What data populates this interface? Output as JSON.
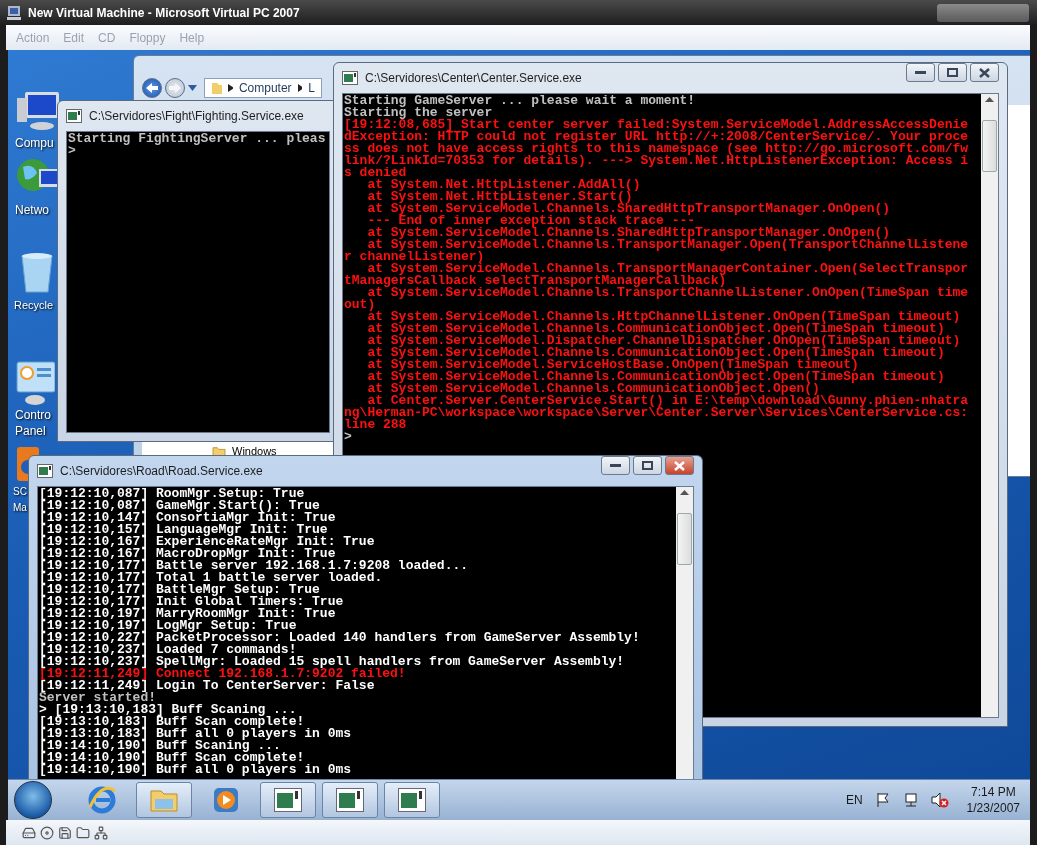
{
  "host": {
    "title": "New Virtual Machine - Microsoft Virtual PC 2007",
    "menu": [
      {
        "label": "Action",
        "disabled": true
      },
      {
        "label": "Edit",
        "disabled": true
      },
      {
        "label": "CD",
        "disabled": true
      },
      {
        "label": "Floppy",
        "disabled": true
      },
      {
        "label": "Help",
        "disabled": true
      }
    ]
  },
  "desktop_icons": [
    {
      "kind": "computer",
      "label": [
        "Compu"
      ]
    },
    {
      "kind": "network",
      "label": [
        "Netwo"
      ]
    },
    {
      "kind": "recycle",
      "label": [
        "Recycle"
      ]
    },
    {
      "kind": "control",
      "label": [
        "Contro",
        "Panel"
      ]
    },
    {
      "kind": "app",
      "label": [
        "SC",
        "Ma"
      ]
    }
  ],
  "explorer": {
    "breadcrumb": [
      "Computer",
      "L"
    ],
    "folder": "Windows"
  },
  "windows": [
    {
      "title": "C:\\Servidores\\Fight\\Fighting.Service.exe",
      "active": false,
      "lines": [
        {
          "kind": "info",
          "text": "Starting FightingServer ... pleas"
        },
        {
          "kind": "info",
          "text": ">"
        }
      ]
    },
    {
      "title": "C:\\Servidores\\Center\\Center.Service.exe",
      "active": false,
      "lines": [
        {
          "kind": "info",
          "text": "Starting GameServer ... please wait a moment!"
        },
        {
          "kind": "info",
          "text": "Starting the server"
        },
        {
          "kind": "error",
          "text": "[19:12:08,685] Start center server failed:System.ServiceModel.AddressAccessDenie"
        },
        {
          "kind": "error",
          "text": "dException: HTTP could not register URL http://+:2008/CenterService/. Your proce"
        },
        {
          "kind": "error",
          "text": "ss does not have access rights to this namespace (see http://go.microsoft.com/fw"
        },
        {
          "kind": "error",
          "text": "link/?LinkId=70353 for details). ---> System.Net.HttpListenerException: Access i"
        },
        {
          "kind": "error",
          "text": "s denied"
        },
        {
          "kind": "error",
          "text": "   at System.Net.HttpListener.AddAll()"
        },
        {
          "kind": "error",
          "text": "   at System.Net.HttpListener.Start()"
        },
        {
          "kind": "error",
          "text": "   at System.ServiceModel.Channels.SharedHttpTransportManager.OnOpen()"
        },
        {
          "kind": "error",
          "text": "   --- End of inner exception stack trace ---"
        },
        {
          "kind": "error",
          "text": "   at System.ServiceModel.Channels.SharedHttpTransportManager.OnOpen()"
        },
        {
          "kind": "error",
          "text": "   at System.ServiceModel.Channels.TransportManager.Open(TransportChannelListene"
        },
        {
          "kind": "error",
          "text": "r channelListener)"
        },
        {
          "kind": "error",
          "text": "   at System.ServiceModel.Channels.TransportManagerContainer.Open(SelectTranspor"
        },
        {
          "kind": "error",
          "text": "tManagersCallback selectTransportManagerCallback)"
        },
        {
          "kind": "error",
          "text": "   at System.ServiceModel.Channels.TransportChannelListener.OnOpen(TimeSpan time"
        },
        {
          "kind": "error",
          "text": "out)"
        },
        {
          "kind": "error",
          "text": "   at System.ServiceModel.Channels.HttpChannelListener.OnOpen(TimeSpan timeout)"
        },
        {
          "kind": "error",
          "text": "   at System.ServiceModel.Channels.CommunicationObject.Open(TimeSpan timeout)"
        },
        {
          "kind": "error",
          "text": "   at System.ServiceModel.Dispatcher.ChannelDispatcher.OnOpen(TimeSpan timeout)"
        },
        {
          "kind": "error",
          "text": "   at System.ServiceModel.Channels.CommunicationObject.Open(TimeSpan timeout)"
        },
        {
          "kind": "error",
          "text": "   at System.ServiceModel.ServiceHostBase.OnOpen(TimeSpan timeout)"
        },
        {
          "kind": "error",
          "text": "   at System.ServiceModel.Channels.CommunicationObject.Open(TimeSpan timeout)"
        },
        {
          "kind": "error",
          "text": "   at System.ServiceModel.Channels.CommunicationObject.Open()"
        },
        {
          "kind": "error",
          "text": "   at Center.Server.CenterService.Start() in E:\\temp\\download\\Gunny.phien-nhatra"
        },
        {
          "kind": "error",
          "text": "ng\\Herman-PC\\workspace\\workspace\\Server\\Center.Server\\Services\\CenterService.cs:"
        },
        {
          "kind": "error",
          "text": "line 288"
        },
        {
          "kind": "info",
          "text": ">"
        }
      ]
    },
    {
      "title": "C:\\Servidores\\Road\\Road.Service.exe",
      "active": true,
      "lines": [
        {
          "kind": "bright",
          "text": "[19:12:10,087] RoomMgr.Setup: True"
        },
        {
          "kind": "bright",
          "text": "[19:12:10,087] GameMgr.Start(): True"
        },
        {
          "kind": "bright",
          "text": "[19:12:10,147] ConsortiaMgr Init: True"
        },
        {
          "kind": "bright",
          "text": "[19:12:10,157] LanguageMgr Init: True"
        },
        {
          "kind": "bright",
          "text": "[19:12:10,167] ExperienceRateMgr Init: True"
        },
        {
          "kind": "bright",
          "text": "[19:12:10,167] MacroDropMgr Init: True"
        },
        {
          "kind": "bright",
          "text": "[19:12:10,177] Battle server 192.168.1.7:9208 loaded..."
        },
        {
          "kind": "bright",
          "text": "[19:12:10,177] Total 1 battle server loaded."
        },
        {
          "kind": "bright",
          "text": "[19:12:10,177] BattleMgr Setup: True"
        },
        {
          "kind": "bright",
          "text": "[19:12:10,177] Init Global Timers: True"
        },
        {
          "kind": "bright",
          "text": "[19:12:10,197] MarryRoomMgr Init: True"
        },
        {
          "kind": "bright",
          "text": "[19:12:10,197] LogMgr Setup: True"
        },
        {
          "kind": "bright",
          "text": "[19:12:10,227] PacketProcessor: Loaded 140 handlers from GameServer Assembly!"
        },
        {
          "kind": "bright",
          "text": "[19:12:10,237] Loaded 7 commands!"
        },
        {
          "kind": "bright",
          "text": "[19:12:10,237] SpellMgr: Loaded 15 spell handlers from GameServer Assembly!"
        },
        {
          "kind": "error",
          "text": "[19:12:11,249] Connect 192.168.1.7:9202 failed!"
        },
        {
          "kind": "bright",
          "text": "[19:12:11,249] Login To CenterServer: False"
        },
        {
          "kind": "info",
          "text": "Server started!"
        },
        {
          "kind": "bright",
          "text": "> [19:13:10,183] Buff Scaning ..."
        },
        {
          "kind": "bright",
          "text": "[19:13:10,183] Buff Scan complete!"
        },
        {
          "kind": "bright",
          "text": "[19:13:10,183] Buff all 0 players in 0ms"
        },
        {
          "kind": "bright",
          "text": "[19:14:10,190] Buff Scaning ..."
        },
        {
          "kind": "bright",
          "text": "[19:14:10,190] Buff Scan complete!"
        },
        {
          "kind": "bright",
          "text": "[19:14:10,190] Buff all 0 players in 0ms"
        }
      ]
    }
  ],
  "taskbar": {
    "buttons": [
      {
        "kind": "browser"
      },
      {
        "kind": "folder"
      },
      {
        "kind": "media"
      },
      {
        "kind": "console"
      },
      {
        "kind": "console"
      },
      {
        "kind": "console"
      }
    ],
    "tray": {
      "language": "EN",
      "time": "7:14 PM",
      "date": "1/23/2007"
    }
  }
}
